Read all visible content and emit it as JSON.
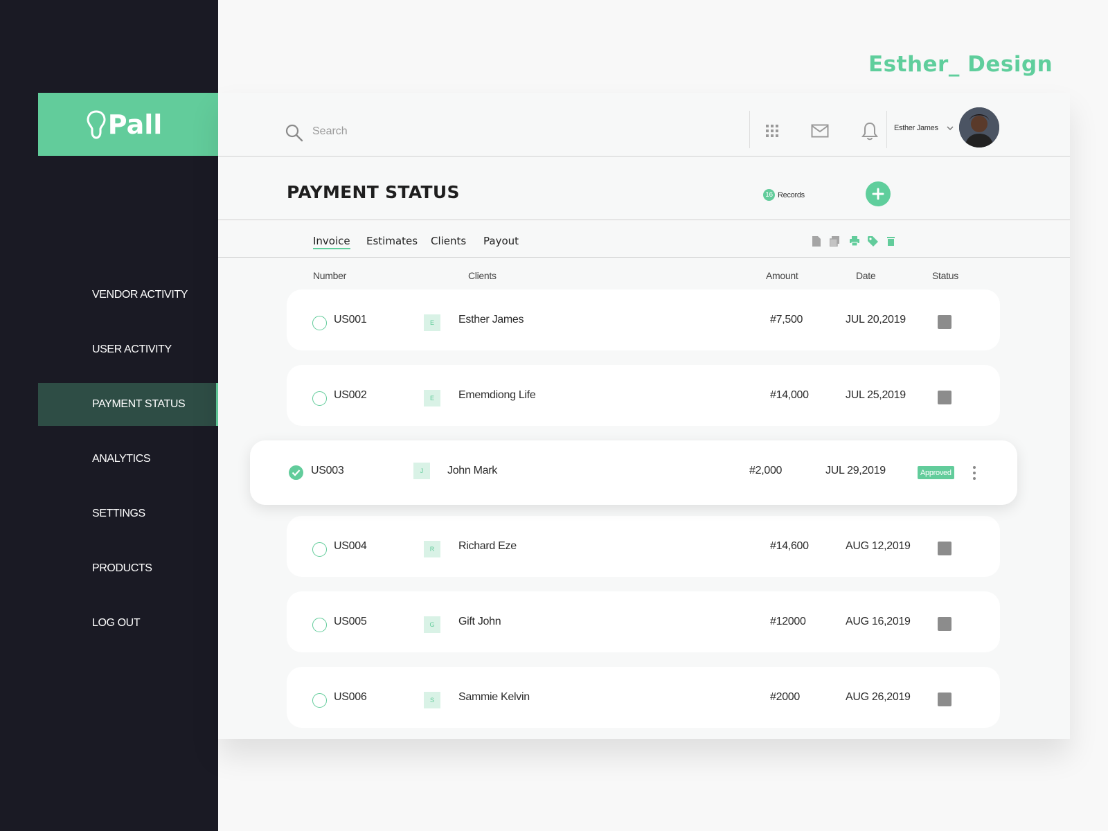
{
  "brand": "Esther_ Design",
  "logo": {
    "text": "Pall"
  },
  "sidebar": {
    "items": [
      {
        "label": "VENDOR ACTIVITY"
      },
      {
        "label": "USER ACTIVITY"
      },
      {
        "label": "PAYMENT STATUS",
        "active": true
      },
      {
        "label": "ANALYTICS"
      },
      {
        "label": "SETTINGS"
      },
      {
        "label": "PRODUCTS"
      },
      {
        "label": "LOG OUT"
      }
    ]
  },
  "header": {
    "search_placeholder": "Search",
    "user_name": "Esther James",
    "icons": [
      "grid-icon",
      "mail-icon",
      "bell-icon"
    ]
  },
  "page": {
    "title": "PAYMENT STATUS",
    "records_count": "16",
    "records_label": "Records"
  },
  "tabs": [
    {
      "label": "Invoice",
      "active": true
    },
    {
      "label": "Estimates"
    },
    {
      "label": "Clients"
    },
    {
      "label": "Payout"
    }
  ],
  "toolbar_icons": [
    "document-icon",
    "copy-icon",
    "print-icon",
    "tag-icon",
    "trash-icon"
  ],
  "table": {
    "columns": [
      "Number",
      "Clients",
      "Amount",
      "Date",
      "Status"
    ],
    "rows": [
      {
        "number": "US001",
        "initial": "E",
        "client": "Esther James",
        "amount": "#7,500",
        "date": "JUL 20,2019"
      },
      {
        "number": "US002",
        "initial": "E",
        "client": "Ememdiong Life",
        "amount": "#14,000",
        "date": "JUL 25,2019"
      },
      {
        "number": "US003",
        "initial": "J",
        "client": "John Mark",
        "amount": "#2,000",
        "date": "JUL 29,2019",
        "status": "Approved",
        "selected": true
      },
      {
        "number": "US004",
        "initial": "R",
        "client": "Richard Eze",
        "amount": "#14,600",
        "date": "AUG 12,2019"
      },
      {
        "number": "US005",
        "initial": "G",
        "client": "Gift John",
        "amount": "#12000",
        "date": "AUG 16,2019"
      },
      {
        "number": "US006",
        "initial": "S",
        "client": "Sammie Kelvin",
        "amount": "#2000",
        "date": "AUG 26,2019"
      }
    ]
  },
  "colors": {
    "accent": "#62cc9b",
    "sidebar_bg": "#1a1a24",
    "active_nav": "#2e4d45",
    "status_gray": "#8c8c8c"
  }
}
